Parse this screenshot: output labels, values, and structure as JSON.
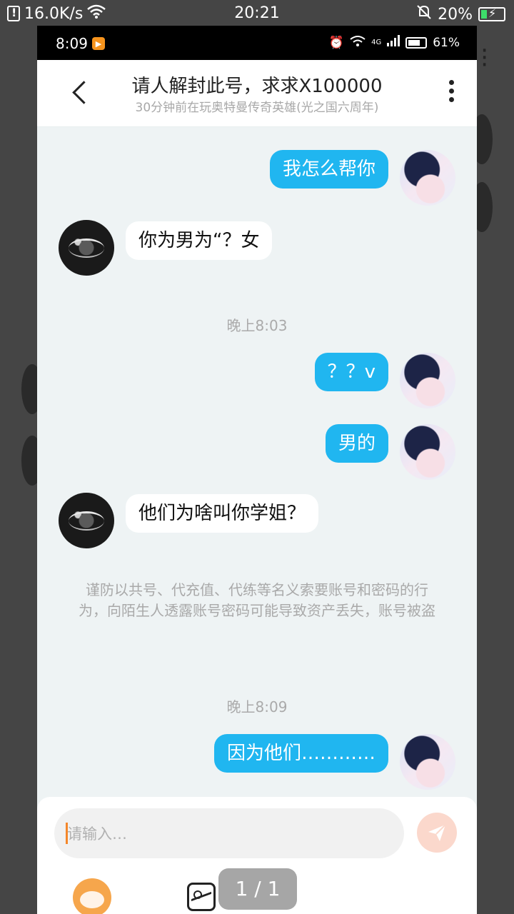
{
  "outer_status": {
    "speed": "16.0K/s",
    "time": "20:21",
    "battery": "20%"
  },
  "inner_status": {
    "time": "8:09",
    "battery": "61%",
    "network": "4G"
  },
  "header": {
    "title": "请人解封此号，求求X100000",
    "subtitle": "30分钟前在玩奥特曼传奇英雄(光之国六周年)"
  },
  "messages": [
    {
      "from": "me",
      "text": "我怎么帮你"
    },
    {
      "from": "other",
      "text": "你为男为“？女"
    },
    {
      "type": "time",
      "text": "晚上8:03"
    },
    {
      "from": "me",
      "text": "？？v"
    },
    {
      "from": "me",
      "text": "男的"
    },
    {
      "from": "other",
      "text": "他们为啥叫你学姐？"
    },
    {
      "type": "notice",
      "text": "谨防以共号、代充值、代练等名义索要账号和密码的行为，向陌生人透露账号密码可能导致资产丢失，账号被盗"
    },
    {
      "type": "time",
      "text": "晚上8:09"
    },
    {
      "from": "me",
      "text": "因为他们…………"
    }
  ],
  "input": {
    "placeholder": "请输入…"
  },
  "pager": {
    "label": "1 / 1"
  },
  "colors": {
    "bubble_me": "#20b6f0",
    "send_button": "#fbd8cc",
    "accent": "#f5872a"
  }
}
